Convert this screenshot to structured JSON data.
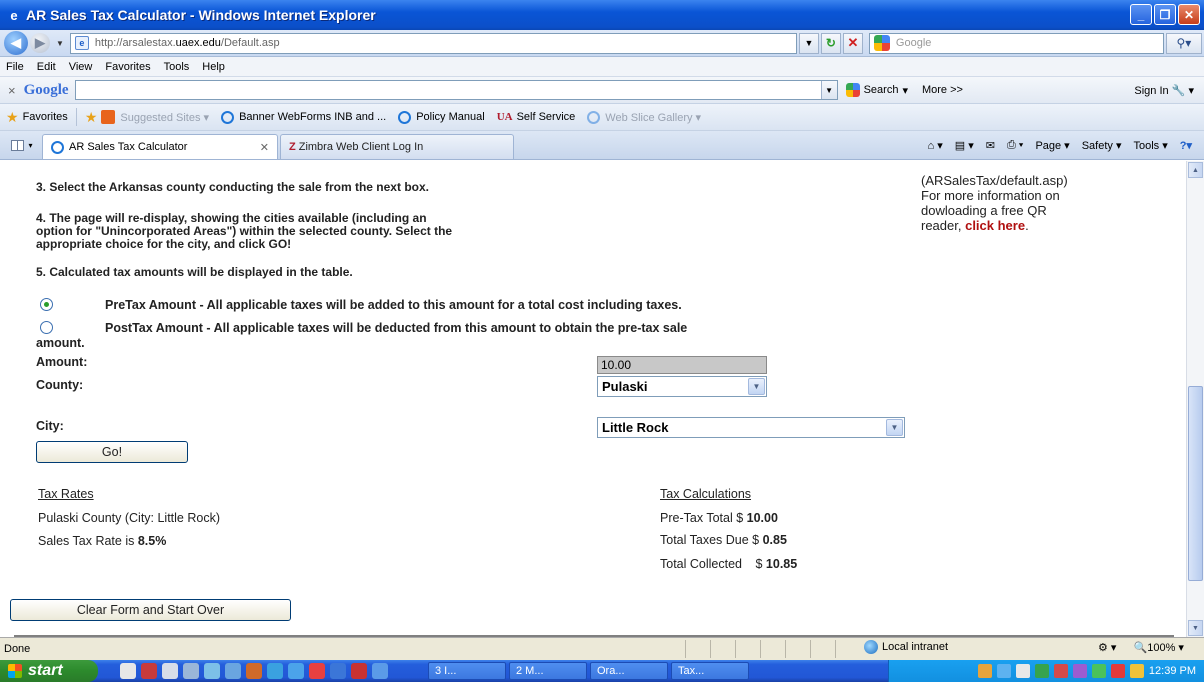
{
  "window": {
    "title": "AR Sales Tax Calculator - Windows Internet Explorer",
    "controls": [
      "minimize",
      "maximize",
      "close"
    ]
  },
  "addressbar": {
    "url_prefix": "http://arsalestax.",
    "url_domain": "uaex.edu",
    "url_suffix": "/Default.asp",
    "search_placeholder": "Google"
  },
  "menubar": {
    "items": [
      "File",
      "Edit",
      "View",
      "Favorites",
      "Tools",
      "Help"
    ]
  },
  "google_toolbar": {
    "close": "×",
    "logo": "Google",
    "search_label": "Search",
    "more_label": "More >>",
    "signin_label": "Sign In"
  },
  "favorites_bar": {
    "favorites_label": "Favorites",
    "links": [
      {
        "label": "Suggested Sites ▾",
        "dim": true
      },
      {
        "label": "Banner WebForms INB and ...",
        "dim": false
      },
      {
        "label": "Policy Manual",
        "dim": false
      },
      {
        "label": "Self Service",
        "dim": false
      },
      {
        "label": "Web Slice Gallery ▾",
        "dim": true
      }
    ]
  },
  "tabs": [
    {
      "label": "AR Sales Tax Calculator",
      "active": true
    },
    {
      "label": "Zimbra Web Client Log In",
      "active": false
    }
  ],
  "command_bar": {
    "page": "Page ▾",
    "safety": "Safety ▾",
    "tools": "Tools ▾"
  },
  "instructions": {
    "step3": "3. Select the Arkansas county conducting the sale from the next box.",
    "step4_line1": "4. The page will re-display, showing the cities available (including an",
    "step4_line2": "option for \"Unincorporated Areas\") within the selected county. Select the",
    "step4_line3": "appropriate choice for the city, and click GO!",
    "step5": "5. Calculated tax amounts will be displayed in the table."
  },
  "qr_note": {
    "line1": "(ARSalesTax/default.asp)",
    "line2": "For more information on",
    "line3": "dowloading a free QR",
    "line4_prefix": "reader, ",
    "link": "click here",
    "line4_suffix": "."
  },
  "options": {
    "pretax": {
      "label": "PreTax Amount - All applicable taxes will be added to this amount for a total cost including taxes.",
      "checked": true
    },
    "posttax": {
      "label": "PostTax Amount - All applicable taxes will be deducted from this amount to obtain the pre-tax sale",
      "label_tail": "amount.",
      "checked": false
    }
  },
  "form": {
    "amount_label": "Amount:",
    "amount_value": "10.00",
    "county_label": "County:",
    "county_value": "Pulaski",
    "city_label": "City:",
    "city_value": "Little Rock",
    "go_label": "Go!",
    "clear_label": "Clear Form and Start Over"
  },
  "tax_rates": {
    "heading": "Tax Rates",
    "county_line": "Pulaski County (City: Little Rock)",
    "rate_prefix": "Sales Tax Rate is ",
    "rate_value": "8.5%"
  },
  "tax_calculations": {
    "heading": "Tax Calculations",
    "pretax_prefix": "Pre-Tax Total $ ",
    "pretax_value": "10.00",
    "taxes_prefix": "Total Taxes Due $ ",
    "taxes_value": "0.85",
    "collected_prefix": "Total Collected",
    "collected_currency": "$ ",
    "collected_value": "10.85"
  },
  "statusbar": {
    "status": "Done",
    "zone": "Local intranet",
    "zoom": "100%"
  },
  "taskbar": {
    "start_label": "start",
    "items": [
      "3 I...",
      "2 M...",
      "Ora...",
      "Tax..."
    ],
    "clock": "12:39 PM"
  }
}
